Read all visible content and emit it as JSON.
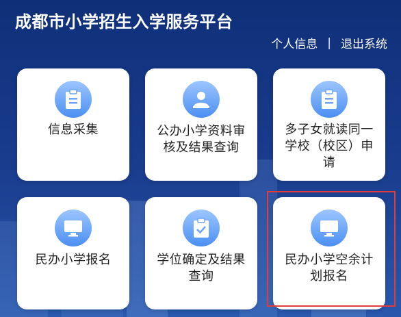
{
  "header": {
    "title": "成都市小学招生入学服务平台",
    "links": {
      "profile": "个人信息",
      "divider": "|",
      "logout": "退出系统"
    }
  },
  "menu": [
    {
      "label": "信息采集",
      "icon": "clipboard-icon"
    },
    {
      "label": "公办小学资料审核及结果查询",
      "icon": "person-icon"
    },
    {
      "label": "多子女就读同一学校（校区）申请",
      "icon": "clipboard-icon"
    },
    {
      "label": "民办小学报名",
      "icon": "monitor-icon"
    },
    {
      "label": "学位确定及结果查询",
      "icon": "clipboard-check-icon"
    },
    {
      "label": "民办小学空余计划报名",
      "icon": "monitor-icon"
    }
  ],
  "colors": {
    "accent": "#4b8ff2",
    "background": "#13357f",
    "highlight": "#e23b3b"
  }
}
